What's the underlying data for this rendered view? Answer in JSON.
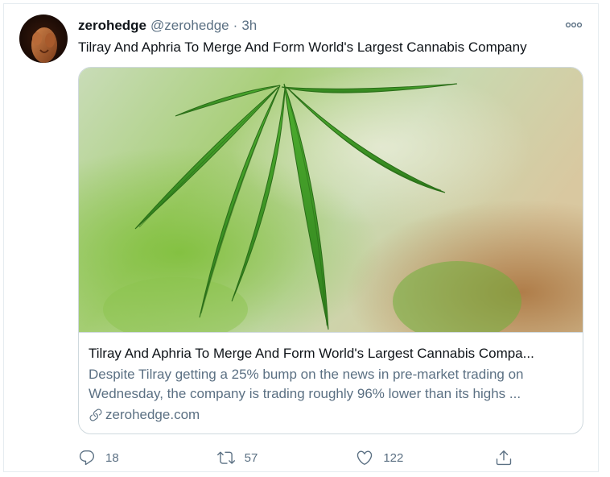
{
  "tweet": {
    "name": "zerohedge",
    "handle": "@zerohedge",
    "separator": "·",
    "time": "3h",
    "text": "Tilray And Aphria To Merge And Form World's Largest Cannabis Company"
  },
  "card": {
    "title": "Tilray And Aphria To Merge And Form World's Largest Cannabis Compa...",
    "description": "Despite Tilray getting a 25% bump on the news in pre-market trading on Wednesday, the company is trading roughly 96% lower than its highs ...",
    "domain": "zerohedge.com"
  },
  "actions": {
    "reply_count": "18",
    "retweet_count": "57",
    "like_count": "122"
  },
  "colors": {
    "text": "#0f1419",
    "secondary": "#5b7083",
    "border": "#cfd9de",
    "leaf": "#3f9a2a"
  }
}
